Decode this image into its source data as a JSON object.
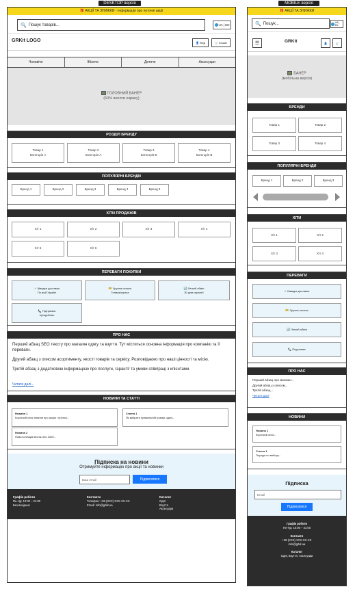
{
  "labels": {
    "desktop": "DESKTOP версія",
    "mobile": "MOBILE версія"
  },
  "promo": "🎁 АКЦІЇ ТА ЗНИЖКИ - Інформація про поточні акції",
  "promo_mobile": "🎁 АКЦІЇ ТА ЗНИЖКИ",
  "search": {
    "placeholder": "Пошук товарів...",
    "placeholder_mobile": "Пошук..."
  },
  "lang": "UA | EN",
  "logo": {
    "desktop": "GRKit LOGO",
    "mobile": "GRKit"
  },
  "header_buttons": {
    "login": "Вхід",
    "cart": "Кошик"
  },
  "nav": [
    "Чоловіче",
    "Жіноче",
    "Дитяче",
    "Аксесуари"
  ],
  "banner": {
    "desktop_l1": "ГОЛОВНИЙ БАНЕР",
    "desktop_l2": "(50% висоти екрану)",
    "mobile_l1": "БАНЕР",
    "mobile_l2": "(мобільна версія)"
  },
  "brand_sections": {
    "title": "РОЗДІЛ БРЕНДУ",
    "items": [
      {
        "name": "Товар 1",
        "cat": "Категорія А"
      },
      {
        "name": "Товар 2",
        "cat": "Категорія А"
      },
      {
        "name": "Товар 3",
        "cat": "Категорія В"
      },
      {
        "name": "Товар 4",
        "cat": "Категорія В"
      }
    ]
  },
  "popular_brands": {
    "title": "ПОПУЛЯРНІ БРЕНДИ",
    "items": [
      "Бренд 1",
      "Бренд 2",
      "Бренд 3",
      "Бренд 4",
      "Бренд 5"
    ]
  },
  "hits": {
    "title": "ХІТИ ПРОДАЖІВ",
    "items": [
      "Хіт 1",
      "Хіт 2",
      "Хіт 3",
      "Хіт 4",
      "Хіт 5",
      "Хіт 6"
    ]
  },
  "advantages": {
    "title": "ПЕРЕВАГИ ПОКУПКИ",
    "items": [
      {
        "l1": "✓ Швидка доставка",
        "l2": "По всій Україні"
      },
      {
        "l1": "💳 Зручна оплата",
        "l2": "Готівка/картка"
      },
      {
        "l1": "🔄 Легкий обмін",
        "l2": "30 днів гарантії"
      },
      {
        "l1": "📞 Підтримка",
        "l2": "Цілодобово"
      }
    ]
  },
  "about": {
    "title": "ПРО НАС",
    "p1": "Перший абзац SEO тексту про магазин одягу та взуття. Тут міститься основна інформація про компанію та її переваги.",
    "p2": "Другий абзац з описом асортименту, якості товарів та сервісу. Розповідаємо про наші цінності та місію.",
    "p3": "Третій абзац з додатковою інформацією про послуги, гарантії та умови співпраці з клієнтами.",
    "more": "Читати далі..."
  },
  "news": {
    "title": "НОВИНИ ТА СТАТТІ",
    "items": [
      {
        "title": "Новина 1",
        "text": "Короткий опис новини про акцію і пропоз..."
      },
      {
        "title": "Стаття 1",
        "text": "Як вибрати правильний розмір одягу..."
      },
      {
        "title": "Новина 2",
        "text": "Нова колекція весна-літо 2025..."
      }
    ]
  },
  "subscribe": {
    "title": "Підписка на новини",
    "subtitle": "Отримуйте інформацію про акції та новинки",
    "placeholder": "Ваш email",
    "button": "Підписатися"
  },
  "footer": {
    "hours_title": "Графік роботи",
    "hours": "Пн-Нд: 10:00 – 21:00",
    "hours_extra": "Без вихідних",
    "contacts_title": "Контакти",
    "phone": "Телефон: +38 (XXX) XXX-XX-XX",
    "email": "Email: info@grkit.ua",
    "catalog_title": "Каталог",
    "catalog": [
      "Одяг",
      "Взуття",
      "Аксесуари"
    ]
  },
  "mobile": {
    "brands_title": "БРЕНДИ",
    "brands": [
      "Товар 1",
      "Товар 2",
      "Товар 3",
      "Товар 4"
    ],
    "popular_title": "ПОПУЛЯРНІ БРЕНДИ",
    "popular": [
      "Бренд 1",
      "Бренд 2",
      "Бренд 3"
    ],
    "hits_title": "ХІТИ",
    "hits": [
      "Хіт 1",
      "Хіт 2",
      "Хіт 3",
      "Хіт 4"
    ],
    "adv_title": "ПЕРЕВАГИ",
    "adv": [
      "✓ Швидка доставка",
      "💳 Зручна оплата",
      "🔄 Легкий обмін",
      "📞 Підтримка"
    ],
    "about_title": "ПРО НАС",
    "about_lines": [
      "Перший абзац про магазин...",
      "Другий абзац з описом...",
      "Третій абзац..."
    ],
    "more": "Читати далі",
    "news_title": "НОВИНИ",
    "news": [
      {
        "title": "Новина 1",
        "text": "Короткий опис..."
      },
      {
        "title": "Стаття 1",
        "text": "Поради по вибору..."
      }
    ],
    "sub_title": "Підписка",
    "sub_placeholder": "Email",
    "sub_button": "Підписатися",
    "f_hours_title": "Графік роботи",
    "f_hours": "Пн-Нд: 10:00 – 21:00",
    "f_contacts_title": "Контакти",
    "f_phone": "+38 (XXX) XXX-XX-XX",
    "f_email": "info@grkit.ua",
    "f_catalog_title": "Каталог",
    "f_catalog": "Одяг, Взуття, Аксесуари"
  },
  "colors": {
    "promo": "#f6d71c",
    "dark": "#2c2c2c",
    "accent": "#1877ff",
    "subscribe_bg": "#e8f4fb"
  }
}
